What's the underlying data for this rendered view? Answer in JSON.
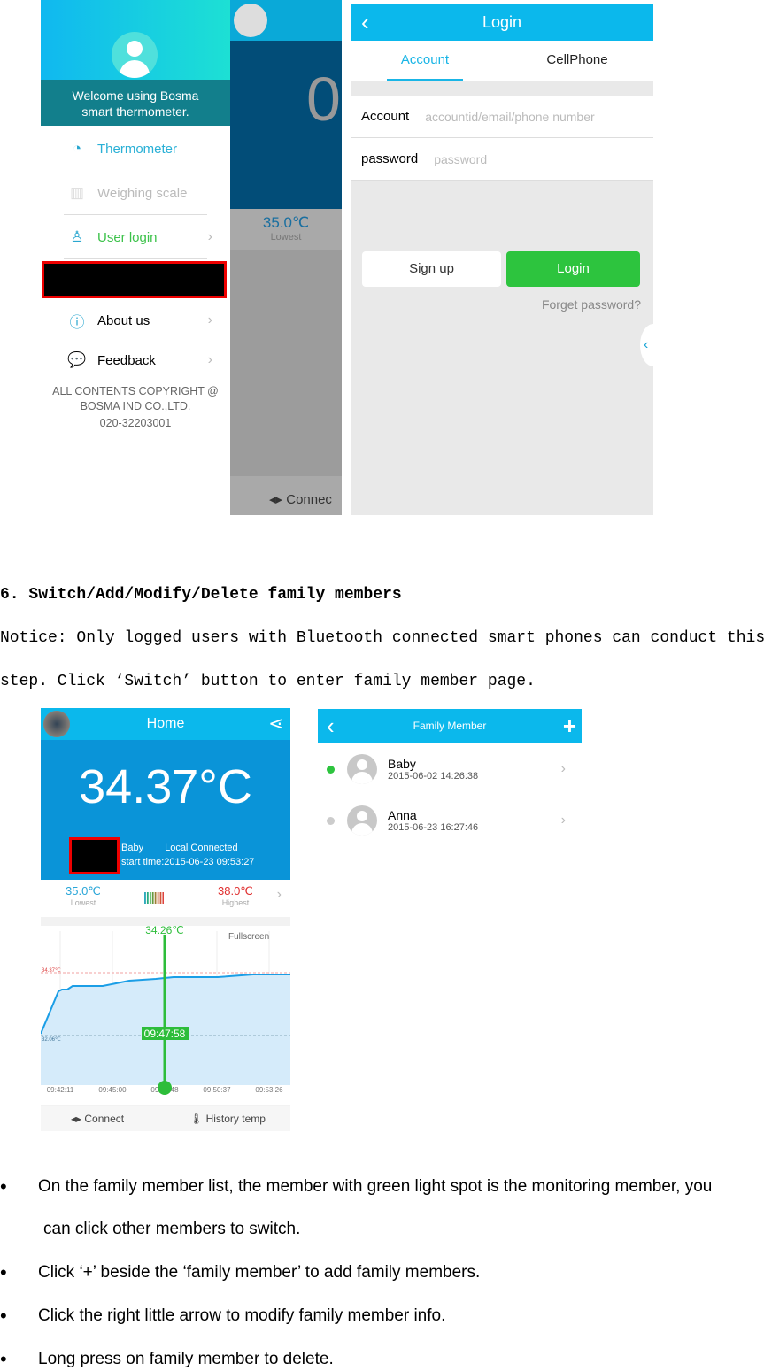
{
  "drawer": {
    "welcome_line1": "Welcome using Bosma",
    "welcome_line2": "smart thermometer.",
    "items": [
      {
        "label": "Thermometer",
        "icon": "thermometer-icon"
      },
      {
        "label": "Weighing scale",
        "icon": "scale-icon"
      },
      {
        "label": "User login",
        "icon": "user-icon"
      },
      {
        "label": "About us",
        "icon": "info-icon"
      },
      {
        "label": "Feedback",
        "icon": "chat-icon"
      }
    ],
    "copyright_line1": "ALL CONTENTS COPYRIGHT @",
    "copyright_line2": "BOSMA IND CO.,LTD.",
    "phone": "020-32203001"
  },
  "side_screen": {
    "big_digit": "0",
    "lowest_value": "35.0℃",
    "lowest_label": "Lowest",
    "connect": "Connec"
  },
  "login": {
    "title": "Login",
    "tabs": [
      "Account",
      "CellPhone"
    ],
    "account_label": "Account",
    "account_placeholder": "accountid/email/phone number",
    "password_label": "password",
    "password_placeholder": "password",
    "signup": "Sign up",
    "login": "Login",
    "forget": "Forget password?"
  },
  "doc": {
    "heading": "6. Switch/Add/Modify/Delete family members",
    "notice_line1": "Notice: Only logged users with Bluetooth connected smart phones can conduct this",
    "notice_line2": "step. Click  ‘Switch’ button to enter family member page.",
    "bullets": [
      "On the family member list, the member with green light spot is the monitoring member, you",
      "can click other members to switch.",
      "Click ‘+’ beside the ‘family member’ to add family members.",
      "Click the right little arrow to modify family member info.",
      "Long press on family member to delete."
    ]
  },
  "home": {
    "title": "Home",
    "temperature": "34.37°C",
    "member": "Baby",
    "status": "Local Connected",
    "start_time": "start time:2015-06-23 09:53:27",
    "lowest_value": "35.0℃",
    "lowest_label": "Lowest",
    "highest_value": "38.0℃",
    "highest_label": "Highest",
    "fullscreen": "Fullscreen",
    "cursor_temp": "34.26℃",
    "cursor_time": "09:47:58",
    "max_line": "34.37℃",
    "min_line": "32.06℃",
    "x_ticks": [
      "09:42:11",
      "09:45:00",
      "09:47:48",
      "09:50:37",
      "09:53:26"
    ],
    "connect": "Connect",
    "history": "History temp",
    "colors": {
      "accent": "#0bb8ec",
      "green": "#2dbd3a",
      "red": "#e03030"
    }
  },
  "family": {
    "title": "Family Member",
    "members": [
      {
        "name": "Baby",
        "time": "2015-06-02 14:26:38",
        "active": true
      },
      {
        "name": "Anna",
        "time": "2015-06-23 16:27:46",
        "active": false
      }
    ]
  }
}
